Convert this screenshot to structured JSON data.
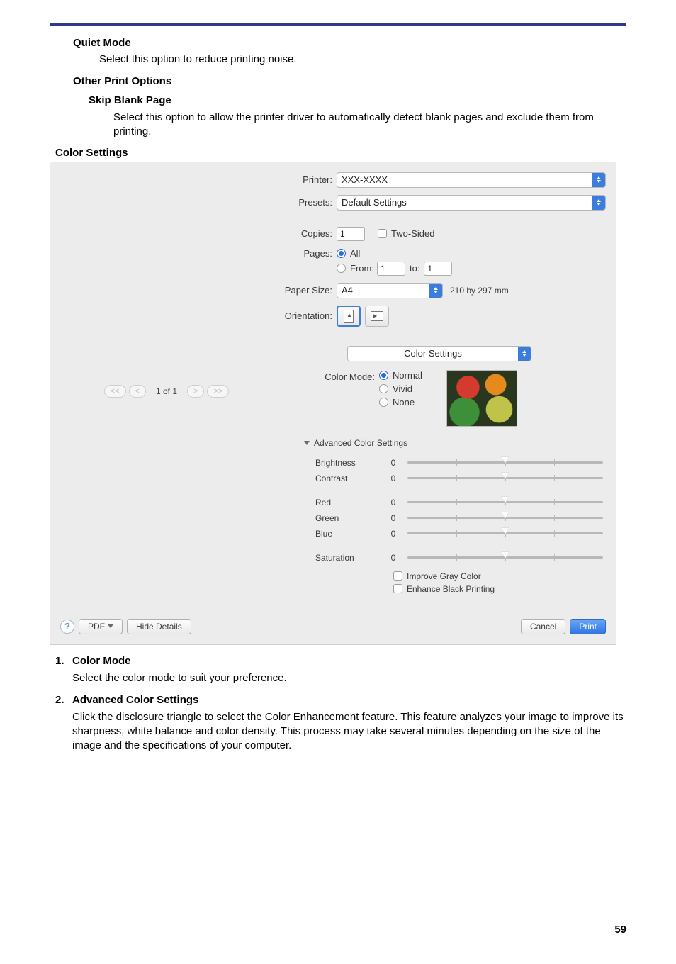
{
  "page_number": "59",
  "quiet_mode": {
    "heading": "Quiet Mode",
    "body": "Select this option to reduce printing noise."
  },
  "other_print": {
    "heading": "Other Print Options",
    "skip_heading": "Skip Blank Page",
    "skip_body": "Select this option to allow the printer driver to automatically detect blank pages and exclude them from printing."
  },
  "color_settings_heading": "Color Settings",
  "dialog": {
    "printer_label": "Printer:",
    "printer_value": "XXX-XXXX",
    "presets_label": "Presets:",
    "presets_value": "Default Settings",
    "copies_label": "Copies:",
    "copies_value": "1",
    "two_sided": "Two-Sided",
    "pages_label": "Pages:",
    "pages_all": "All",
    "pages_from": "From:",
    "pages_from_val": "1",
    "pages_to": "to:",
    "pages_to_val": "1",
    "paper_size_label": "Paper Size:",
    "paper_size_value": "A4",
    "paper_dim": "210 by 297 mm",
    "orientation_label": "Orientation:",
    "section": "Color Settings",
    "color_mode_label": "Color Mode:",
    "color_modes": {
      "normal": "Normal",
      "vivid": "Vivid",
      "none": "None"
    },
    "adv_label": "Advanced Color Settings",
    "sliders": {
      "brightness": {
        "label": "Brightness",
        "value": "0"
      },
      "contrast": {
        "label": "Contrast",
        "value": "0"
      },
      "red": {
        "label": "Red",
        "value": "0"
      },
      "green": {
        "label": "Green",
        "value": "0"
      },
      "blue": {
        "label": "Blue",
        "value": "0"
      },
      "saturation": {
        "label": "Saturation",
        "value": "0"
      }
    },
    "improve_gray": "Improve Gray Color",
    "enhance_black": "Enhance Black Printing",
    "pager": "1 of 1",
    "help": "?",
    "pdf": "PDF",
    "hide_details": "Hide Details",
    "cancel": "Cancel",
    "print": "Print"
  },
  "explain": {
    "n1": "1.",
    "t1": "Color Mode",
    "b1": "Select the color mode to suit your preference.",
    "n2": "2.",
    "t2": "Advanced Color Settings",
    "b2": "Click the disclosure triangle to select the Color Enhancement feature. This feature analyzes your image to improve its sharpness, white balance and color density. This process may take several minutes depending on the size of the image and the specifications of your computer."
  }
}
